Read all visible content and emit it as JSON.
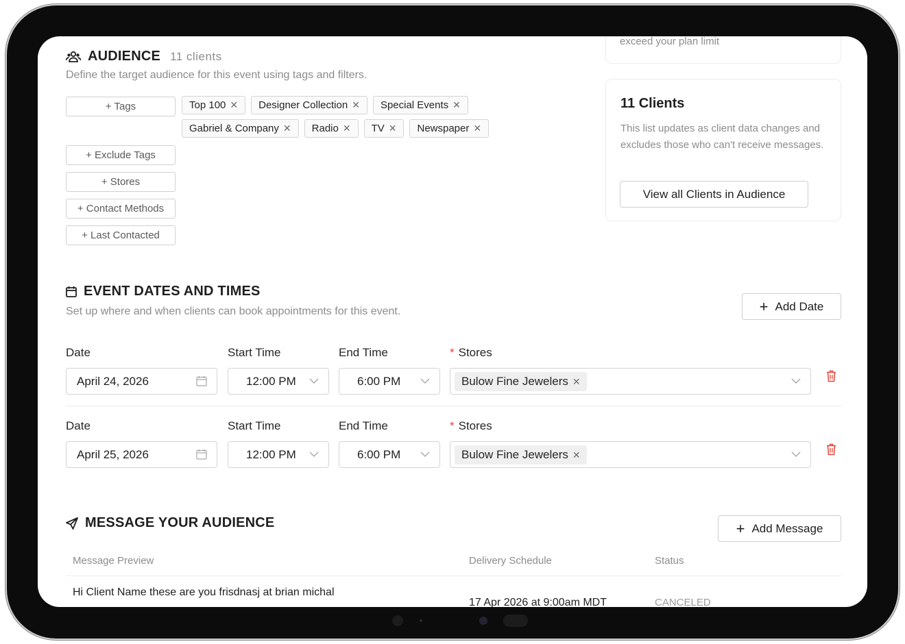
{
  "audience": {
    "title": "AUDIENCE",
    "count": "11 clients",
    "description": "Define the target audience for this event using tags and filters.",
    "filters": [
      "+ Tags",
      "+ Exclude Tags",
      "+ Stores",
      "+ Contact Methods",
      "+ Last Contacted"
    ],
    "tags": [
      "Top 100",
      "Designer Collection",
      "Special Events",
      "Gabriel & Company",
      "Radio",
      "TV",
      "Newspaper"
    ]
  },
  "plan_card": {
    "text": "exceed your plan limit"
  },
  "clients_card": {
    "title": "11 Clients",
    "text": "This list updates as client data changes and excludes those who can't receive messages.",
    "button": "View all Clients in Audience"
  },
  "event_dates": {
    "title": "EVENT DATES AND TIMES",
    "description": "Set up where and when clients can book appointments for this event.",
    "add_button": "Add Date",
    "labels": {
      "date": "Date",
      "start": "Start Time",
      "end": "End Time",
      "stores": "Stores",
      "required_mark": "*"
    },
    "rows": [
      {
        "date": "April 24, 2026",
        "start": "12:00 PM",
        "end": "6:00 PM",
        "store": "Bulow Fine Jewelers"
      },
      {
        "date": "April 25, 2026",
        "start": "12:00 PM",
        "end": "6:00 PM",
        "store": "Bulow Fine Jewelers"
      }
    ]
  },
  "messages": {
    "title": "MESSAGE YOUR AUDIENCE",
    "add_button": "Add Message",
    "columns": [
      "Message Preview",
      "Delivery Schedule",
      "Status"
    ],
    "rows": [
      {
        "preview": "Hi Client Name these are you frisdnasj at brian michal",
        "schedule": "17 Apr 2026 at 9:00am MDT",
        "status": "CANCELED"
      }
    ]
  },
  "colors": {
    "danger": "#e8443a",
    "muted": "#8c8c8c",
    "border": "#d4d4d4"
  }
}
